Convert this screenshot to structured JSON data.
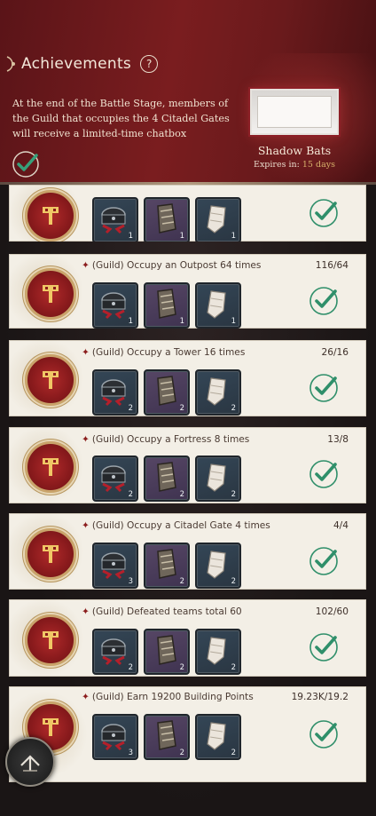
{
  "header": {
    "title": "Achievements",
    "help_icon_glyph": "?",
    "description": "At the end of the Battle Stage, members of the Guild that occupies the 4 Citadel Gates will receive a limited-time chatbox",
    "reward": {
      "name": "Shadow Bats",
      "expires_label": "Expires in:",
      "expires_value": "15 days"
    }
  },
  "tasks": [
    {
      "name": "",
      "progress": "",
      "rewards": [
        "1",
        "1",
        "1"
      ],
      "completed": true
    },
    {
      "name": "(Guild) Occupy an Outpost 64 times",
      "progress": "116/64",
      "rewards": [
        "1",
        "1",
        "1"
      ],
      "completed": true
    },
    {
      "name": "(Guild) Occupy a Tower 16 times",
      "progress": "26/16",
      "rewards": [
        "2",
        "2",
        "2"
      ],
      "completed": true
    },
    {
      "name": "(Guild) Occupy a Fortress 8 times",
      "progress": "13/8",
      "rewards": [
        "2",
        "2",
        "2"
      ],
      "completed": true
    },
    {
      "name": "(Guild) Occupy a Citadel Gate 4 times",
      "progress": "4/4",
      "rewards": [
        "3",
        "2",
        "2"
      ],
      "completed": true
    },
    {
      "name": "(Guild) Defeated teams total 60",
      "progress": "102/60",
      "rewards": [
        "2",
        "2",
        "2"
      ],
      "completed": true
    },
    {
      "name": "(Guild) Earn 19200 Building Points",
      "progress": "19.23K/19.2",
      "rewards": [
        "3",
        "2",
        "2"
      ],
      "completed": true
    }
  ],
  "colors": {
    "header_red": "#7a1d1f",
    "card_bg": "#f3efe6",
    "check_green": "#2f8f6a",
    "expires_gold": "#d6b06a"
  },
  "icons": {
    "help": "help-icon",
    "task_badge": "guild-hammer-emblem-icon",
    "reward_1": "chest-icon",
    "reward_2": "gauntlet-icon",
    "reward_3": "cloth-icon",
    "done": "checkmark-icon",
    "back": "back-arrow-icon"
  }
}
